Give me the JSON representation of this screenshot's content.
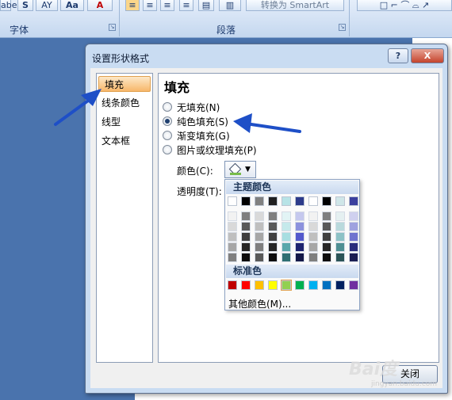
{
  "ribbon": {
    "buttons": [
      {
        "label": "abe"
      },
      {
        "label": "S"
      },
      {
        "label": "AY"
      },
      {
        "label": "Aa"
      },
      {
        "label": "A"
      }
    ],
    "smartart_label": "转换为 SmartArt",
    "group_font": "字体",
    "group_paragraph": "段落"
  },
  "dialog": {
    "title": "设置形状格式",
    "help": "?",
    "close": "X",
    "nav": [
      "填充",
      "线条颜色",
      "线型",
      "文本框"
    ],
    "section_title": "填充",
    "radios": [
      {
        "label": "无填充(N)",
        "checked": false
      },
      {
        "label": "纯色填充(S)",
        "checked": true
      },
      {
        "label": "渐变填充(G)",
        "checked": false
      },
      {
        "label": "图片或纹理填充(P)",
        "checked": false
      }
    ],
    "color_label": "颜色(C):",
    "transparency_label": "透明度(T):",
    "close_button": "关闭"
  },
  "palette": {
    "theme_header": "主题颜色",
    "standard_header": "标准色",
    "more_colors": "其他颜色(M)...",
    "theme_top": [
      "#ffffff",
      "#000000",
      "#808080",
      "#1f1f1f",
      "#b7e3e6",
      "#2c3a8a",
      "#ffffff",
      "#000000",
      "#cfe6e8",
      "#3b3f9e"
    ],
    "theme_columns": [
      [
        "#f2f2f2",
        "#d9d9d9",
        "#bfbfbf",
        "#a6a6a6",
        "#7f7f7f"
      ],
      [
        "#7f7f7f",
        "#595959",
        "#3f3f3f",
        "#262626",
        "#0d0d0d"
      ],
      [
        "#d9d9d9",
        "#bfbfbf",
        "#a6a6a6",
        "#7f7f7f",
        "#595959"
      ],
      [
        "#7f7f7f",
        "#595959",
        "#404040",
        "#262626",
        "#0d0d0d"
      ],
      [
        "#e2f4f5",
        "#c5e9eb",
        "#a8dee1",
        "#5aa7ab",
        "#2f6f72"
      ],
      [
        "#c5c8ee",
        "#8c92dd",
        "#5359cc",
        "#1e2470",
        "#141848"
      ],
      [
        "#f2f2f2",
        "#d9d9d9",
        "#bfbfbf",
        "#a6a6a6",
        "#7f7f7f"
      ],
      [
        "#7f7f7f",
        "#595959",
        "#404040",
        "#262626",
        "#0d0d0d"
      ],
      [
        "#e5f0f1",
        "#b9d9dc",
        "#8dc2c6",
        "#4f8f93",
        "#2b5457"
      ],
      [
        "#cfd0ef",
        "#9fa2df",
        "#6f74cf",
        "#2a2e7c",
        "#1b1e52"
      ]
    ],
    "standard": [
      "#c00000",
      "#ff0000",
      "#ffc000",
      "#ffff00",
      "#92d050",
      "#00b050",
      "#00b0f0",
      "#0070c0",
      "#002060",
      "#7030a0"
    ]
  },
  "watermark": {
    "text": "Bai度",
    "sub": "jingyan.baidu.com"
  }
}
